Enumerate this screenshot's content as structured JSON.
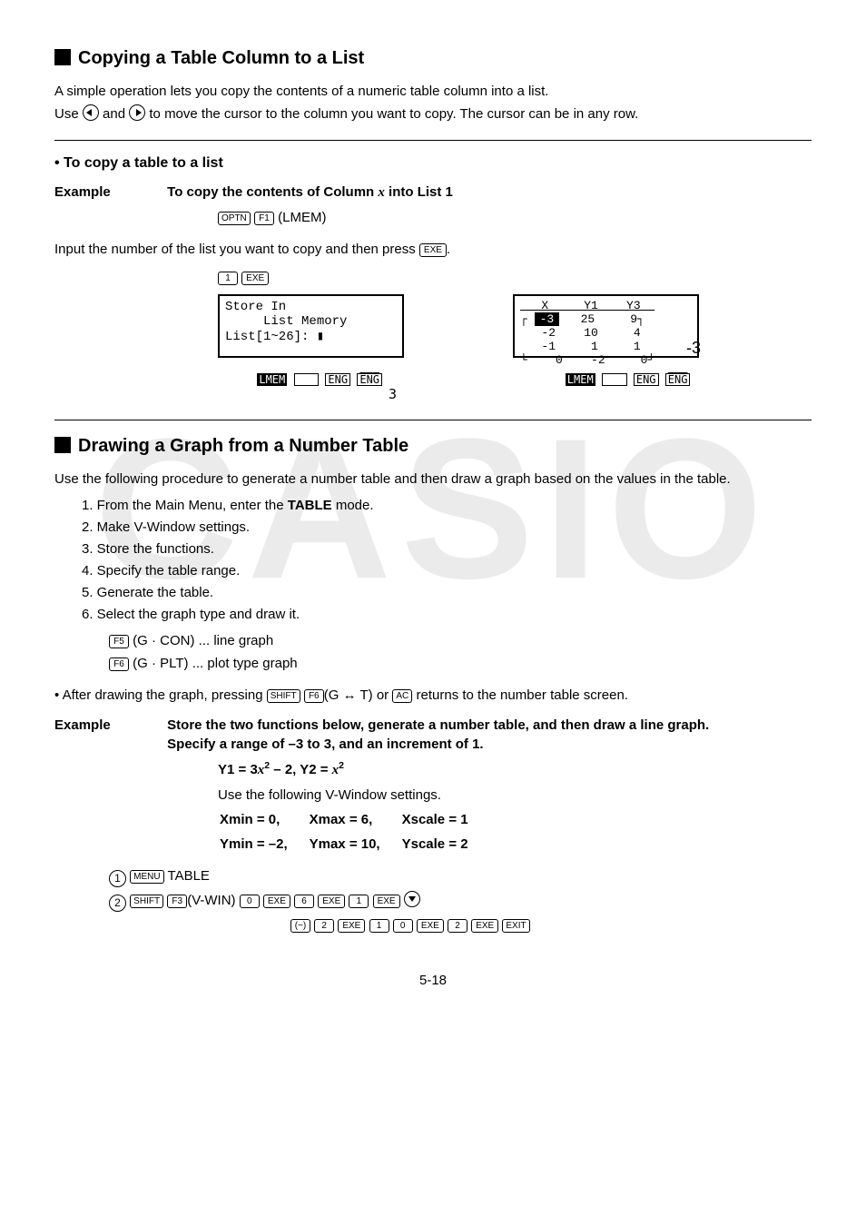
{
  "watermark": "CASIO",
  "section1": {
    "title": "Copying a Table Column to a List",
    "p1": "A simple operation lets you copy the contents of a numeric table column into a list.",
    "p2_a": "Use ",
    "p2_b": " and ",
    "p2_c": " to move the cursor to the column you want to copy. The cursor can be in any row.",
    "sub": "To copy a table to a list",
    "ex_label": "Example",
    "ex_text_a": "To copy the contents of Column ",
    "ex_text_b": " into List 1",
    "k_optn": "OPTN",
    "k_f1": "F1",
    "lmem": "(LMEM)",
    "p3_a": "Input the number of the list you want to copy and then press ",
    "p3_b": ".",
    "k_1": "1",
    "k_exe": "EXE",
    "lcd1_l1": "Store In",
    "lcd1_l2": "     List Memory",
    "lcd1_l3": "List[1~26]: ▮",
    "lcd1_r": "3",
    "lcd_tabs_lmem": "LMEM",
    "lcd_tabs_eng": "ENG",
    "lcd2_hdr": "   X     Y1    Y3  ",
    "lcd2_r1a": "-3",
    "lcd2_r1b": "   25     9",
    "lcd2_r2": "   -2    10     4",
    "lcd2_r3": "   -1     1     1",
    "lcd2_r4": "    0    -2     0",
    "lcd2_neg": "-3"
  },
  "section2": {
    "title": "Drawing a Graph from a Number Table",
    "p1": "Use the following procedure to generate a number table and then draw a graph based on the values in the table.",
    "steps": [
      "1. From the Main Menu, enter the TABLE mode.",
      "2. Make V-Window settings.",
      "3. Store the functions.",
      "4. Specify the table range.",
      "5. Generate the table.",
      "6. Select the graph type and draw it."
    ],
    "k_f5": "F5",
    "gcon": "(G · CON) ... line graph",
    "k_f6": "F6",
    "gplt": "(G · PLT) ... plot type graph",
    "bullet_a": "After drawing the graph, pressing ",
    "k_shift": "SHIFT",
    "gt": "(G ↔ T) or ",
    "k_ac": "AC",
    "bullet_b": " returns to the number table screen.",
    "ex_label": "Example",
    "ex_text": "Store the two functions below, generate a number table, and then draw a line graph.  Specify a range of –3 to 3, and an increment of 1.",
    "eq_a": "Y1 = 3",
    "eq_b": " – 2,  Y2 = ",
    "vw_intro": "Use the following V-Window settings.",
    "vw": {
      "xmin": "Xmin = 0,",
      "xmax": "Xmax = 6,",
      "xscale": "Xscale = 1",
      "ymin": "Ymin = –2,",
      "ymax": "Ymax = 10,",
      "yscale": "Yscale = 2"
    },
    "k_menu": "MENU",
    "table_word": " TABLE",
    "k_f3": "F3",
    "vwin": "(V-WIN)",
    "k_0": "0",
    "k_6": "6",
    "k_2": "2",
    "k_neg": "(−)",
    "k_10a": "1",
    "k_10b": "0",
    "k_exit": "EXIT"
  },
  "pagenum": "5-18"
}
